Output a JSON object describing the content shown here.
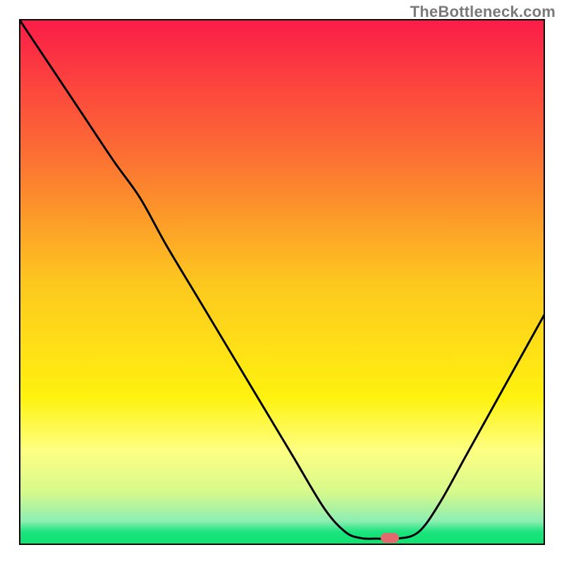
{
  "watermark": "TheBottleneck.com",
  "chart_data": {
    "type": "line",
    "title": "",
    "xlabel": "",
    "ylabel": "",
    "xlim": [
      0,
      100
    ],
    "ylim": [
      0,
      100
    ],
    "grid": false,
    "legend": false,
    "background_gradient": {
      "stops": [
        {
          "pos": 0.0,
          "color": "#fb1c48"
        },
        {
          "pos": 0.25,
          "color": "#fc6c34"
        },
        {
          "pos": 0.5,
          "color": "#fdc71f"
        },
        {
          "pos": 0.72,
          "color": "#fef20f"
        },
        {
          "pos": 0.82,
          "color": "#feff82"
        },
        {
          "pos": 0.9,
          "color": "#d6f98c"
        },
        {
          "pos": 0.955,
          "color": "#8ceeb2"
        },
        {
          "pos": 0.975,
          "color": "#1be47e"
        },
        {
          "pos": 1.0,
          "color": "#10e070"
        }
      ]
    },
    "series": [
      {
        "name": "bottleneck-curve",
        "color": "#000000",
        "x": [
          0.0,
          6.0,
          12.0,
          18.0,
          23.0,
          28.0,
          34.0,
          40.0,
          46.0,
          52.0,
          58.0,
          62.0,
          65.0,
          68.0,
          72.0,
          76.0,
          80.0,
          85.0,
          90.0,
          95.0,
          100.0
        ],
        "y": [
          100.0,
          91.0,
          82.0,
          73.0,
          66.0,
          57.0,
          47.0,
          37.0,
          27.0,
          17.0,
          7.0,
          2.5,
          1.3,
          1.2,
          1.2,
          2.5,
          8.0,
          17.0,
          26.0,
          35.0,
          44.0
        ]
      }
    ],
    "marker": {
      "name": "optimum-point",
      "x": 70.5,
      "y": 1.4,
      "color": "#e26a6f"
    },
    "frame_color": "#000000"
  }
}
